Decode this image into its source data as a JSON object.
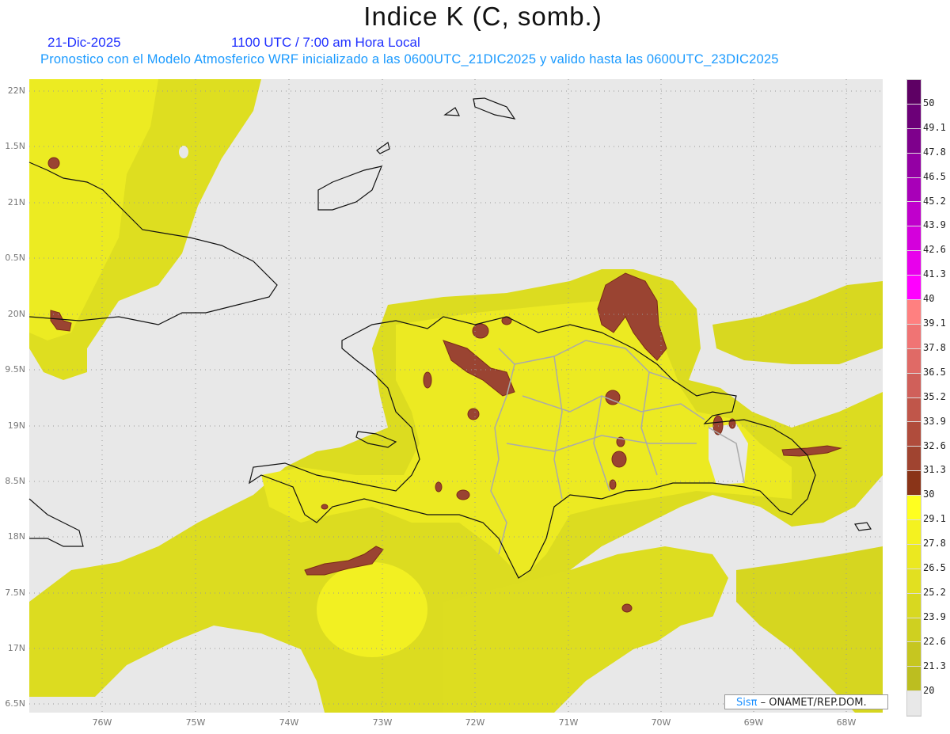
{
  "header": {
    "title": "Indice K (C, somb.)",
    "date": "21-Dic-2025",
    "time": "1100 UTC / 7:00 am Hora Local",
    "subtitle": "Pronostico con el Modelo Atmosferico WRF inicializado a las 0600UTC_21DIC2025 y valido hasta las  0600UTC_23DIC2025"
  },
  "map": {
    "background_color": "#e8e8e8",
    "lat_labels": [
      "22N",
      "1.5N",
      "21N",
      "0.5N",
      "20N",
      "9.5N",
      "19N",
      "8.5N",
      "18N",
      "7.5N",
      "17N",
      "6.5N"
    ],
    "lon_labels": [
      "76W",
      "75W",
      "74W",
      "73W",
      "72W",
      "71W",
      "70W",
      "69W",
      "68W"
    ],
    "grid": "dotted"
  },
  "colorbar": {
    "labels": [
      "50",
      "49.1",
      "47.8",
      "46.5",
      "45.2",
      "43.9",
      "42.6",
      "41.3",
      "40",
      "39.1",
      "37.8",
      "36.5",
      "35.2",
      "33.9",
      "32.6",
      "31.3",
      "30",
      "29.1",
      "27.8",
      "26.5",
      "25.2",
      "23.9",
      "22.6",
      "21.3",
      "20"
    ],
    "colors": [
      "#5e0064",
      "#6c0078",
      "#7e008c",
      "#9400a4",
      "#a800b8",
      "#c000cc",
      "#d400dc",
      "#e800ec",
      "#ff00ff",
      "#ff8080",
      "#f07474",
      "#e06a66",
      "#d0605a",
      "#c0564a",
      "#b04c3c",
      "#a04430",
      "#8a3418",
      "#ffff20",
      "#f4f220",
      "#ebe820",
      "#e2e020",
      "#d8d820",
      "#cfd020",
      "#c6c620",
      "#bcbe20",
      "#e8e8e8"
    ]
  },
  "credit": {
    "brand": "Sisπ",
    "text": " –  ONAMET/REP.DOM."
  }
}
